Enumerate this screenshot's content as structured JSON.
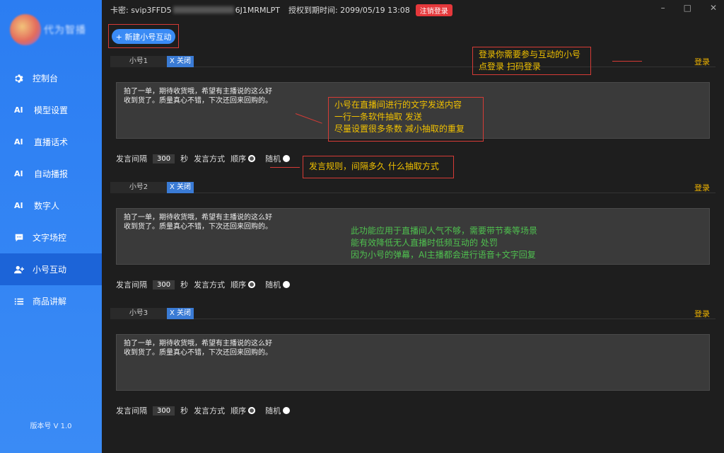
{
  "sidebar": {
    "logo_text": "代为智播",
    "items": [
      {
        "icon": "gear-icon",
        "label": "控制台"
      },
      {
        "icon": "ai-icon",
        "icon_text": "AI",
        "label": "模型设置"
      },
      {
        "icon": "ai-icon",
        "icon_text": "AI",
        "label": "直播话术"
      },
      {
        "icon": "ai-icon",
        "icon_text": "AI",
        "label": "自动播报"
      },
      {
        "icon": "ai-icon",
        "icon_text": "AI",
        "label": "数字人"
      },
      {
        "icon": "chat-icon",
        "label": "文字场控"
      },
      {
        "icon": "user-plus-icon",
        "label": "小号互动"
      },
      {
        "icon": "list-icon",
        "label": "商品讲解"
      }
    ],
    "version": "版本号 V 1.0"
  },
  "header": {
    "card_label": "卡密: svip3FFD5",
    "card_masked": "",
    "card_suffix": "6J1MRMLPT",
    "expire_label": "授权到期时间: 2099/05/19 13:08",
    "logout_label": "注销登录"
  },
  "toolbar": {
    "new_label": "+ 新建小号互动"
  },
  "accounts": [
    {
      "name": "小号1",
      "close": "X 关闭",
      "login": "登录",
      "text": "拍了一单，期待收货哦，希望有主播说的这么好\n收到货了。质量真心不错，下次还回来回购的。",
      "interval_label": "发言间隔",
      "interval": "300",
      "unit": "秒",
      "mode_label": "发言方式",
      "seq": "顺序",
      "rand": "随机"
    },
    {
      "name": "小号2",
      "close": "X 关闭",
      "login": "登录",
      "text": "拍了一单，期待收货哦，希望有主播说的这么好\n收到货了。质量真心不错，下次还回来回购的。",
      "interval_label": "发言间隔",
      "interval": "300",
      "unit": "秒",
      "mode_label": "发言方式",
      "seq": "顺序",
      "rand": "随机"
    },
    {
      "name": "小号3",
      "close": "X 关闭",
      "login": "登录",
      "text": "拍了一单，期待收货哦，希望有主播说的这么好\n收到货了。质量真心不错，下次还回来回购的。",
      "interval_label": "发言间隔",
      "interval": "300",
      "unit": "秒",
      "mode_label": "发言方式",
      "seq": "顺序",
      "rand": "随机"
    }
  ],
  "annotations": {
    "login_note_1": "登录你需要参与互动的小号",
    "login_note_2": "点登录 扫码登录",
    "content_note_1": "小号在直播间进行的文字发送内容",
    "content_note_2": "一行一条软件抽取 发送",
    "content_note_3": "尽量设置很多条数 减小抽取的重复",
    "rules_note": "发言规则，间隔多久  什么抽取方式",
    "feature_note_1": "此功能应用于直播间人气不够，需要带节奏等场景",
    "feature_note_2": "能有效降低无人直播时低频互动的 处罚",
    "feature_note_3": "因为小号的弹幕，AI主播都会进行语音+文字回复"
  },
  "colors": {
    "sidebar": "#2b7df2",
    "accent": "#3a8bf5",
    "danger": "#e5383b",
    "warning": "#f0b400",
    "note_green": "#4fc04f"
  }
}
